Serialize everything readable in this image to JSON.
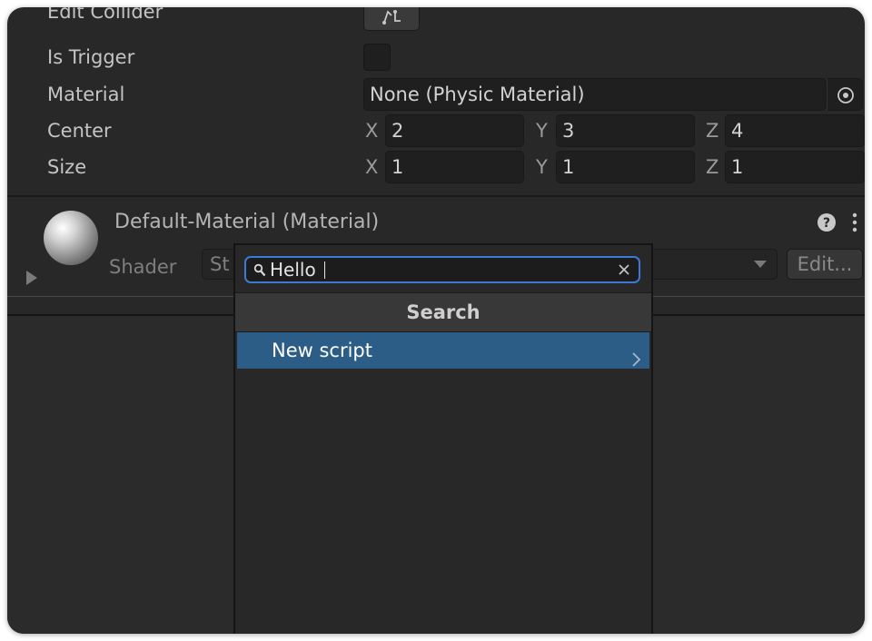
{
  "collider": {
    "edit_collider_label": "Edit Collider",
    "is_trigger_label": "Is Trigger",
    "is_trigger_checked": false,
    "material_label": "Material",
    "material_value": "None (Physic Material)",
    "center_label": "Center",
    "center": {
      "x_label": "X",
      "x": "2",
      "y_label": "Y",
      "y": "3",
      "z_label": "Z",
      "z": "4"
    },
    "size_label": "Size",
    "size": {
      "x_label": "X",
      "x": "1",
      "y_label": "Y",
      "y": "1",
      "z_label": "Z",
      "z": "1"
    }
  },
  "material": {
    "title": "Default-Material (Material)",
    "shader_label": "Shader",
    "shader_value_partial": "St",
    "edit_button_label": "Edit..."
  },
  "popup": {
    "search_value": "Hello",
    "header": "Search",
    "items": [
      {
        "label": "New script",
        "selected": true
      }
    ]
  },
  "colors": {
    "panel_bg": "#282828",
    "field_bg": "#1f1f1f",
    "highlight": "#2c5d87",
    "focus_border": "#3d7ad6",
    "text": "#c4c4c4"
  },
  "icons": [
    "edit-collider-icon",
    "object-picker-icon",
    "help-icon",
    "more-menu-icon",
    "foldout-arrow-icon",
    "search-icon",
    "clear-search-icon",
    "submenu-arrow-icon",
    "dropdown-arrow-icon"
  ]
}
